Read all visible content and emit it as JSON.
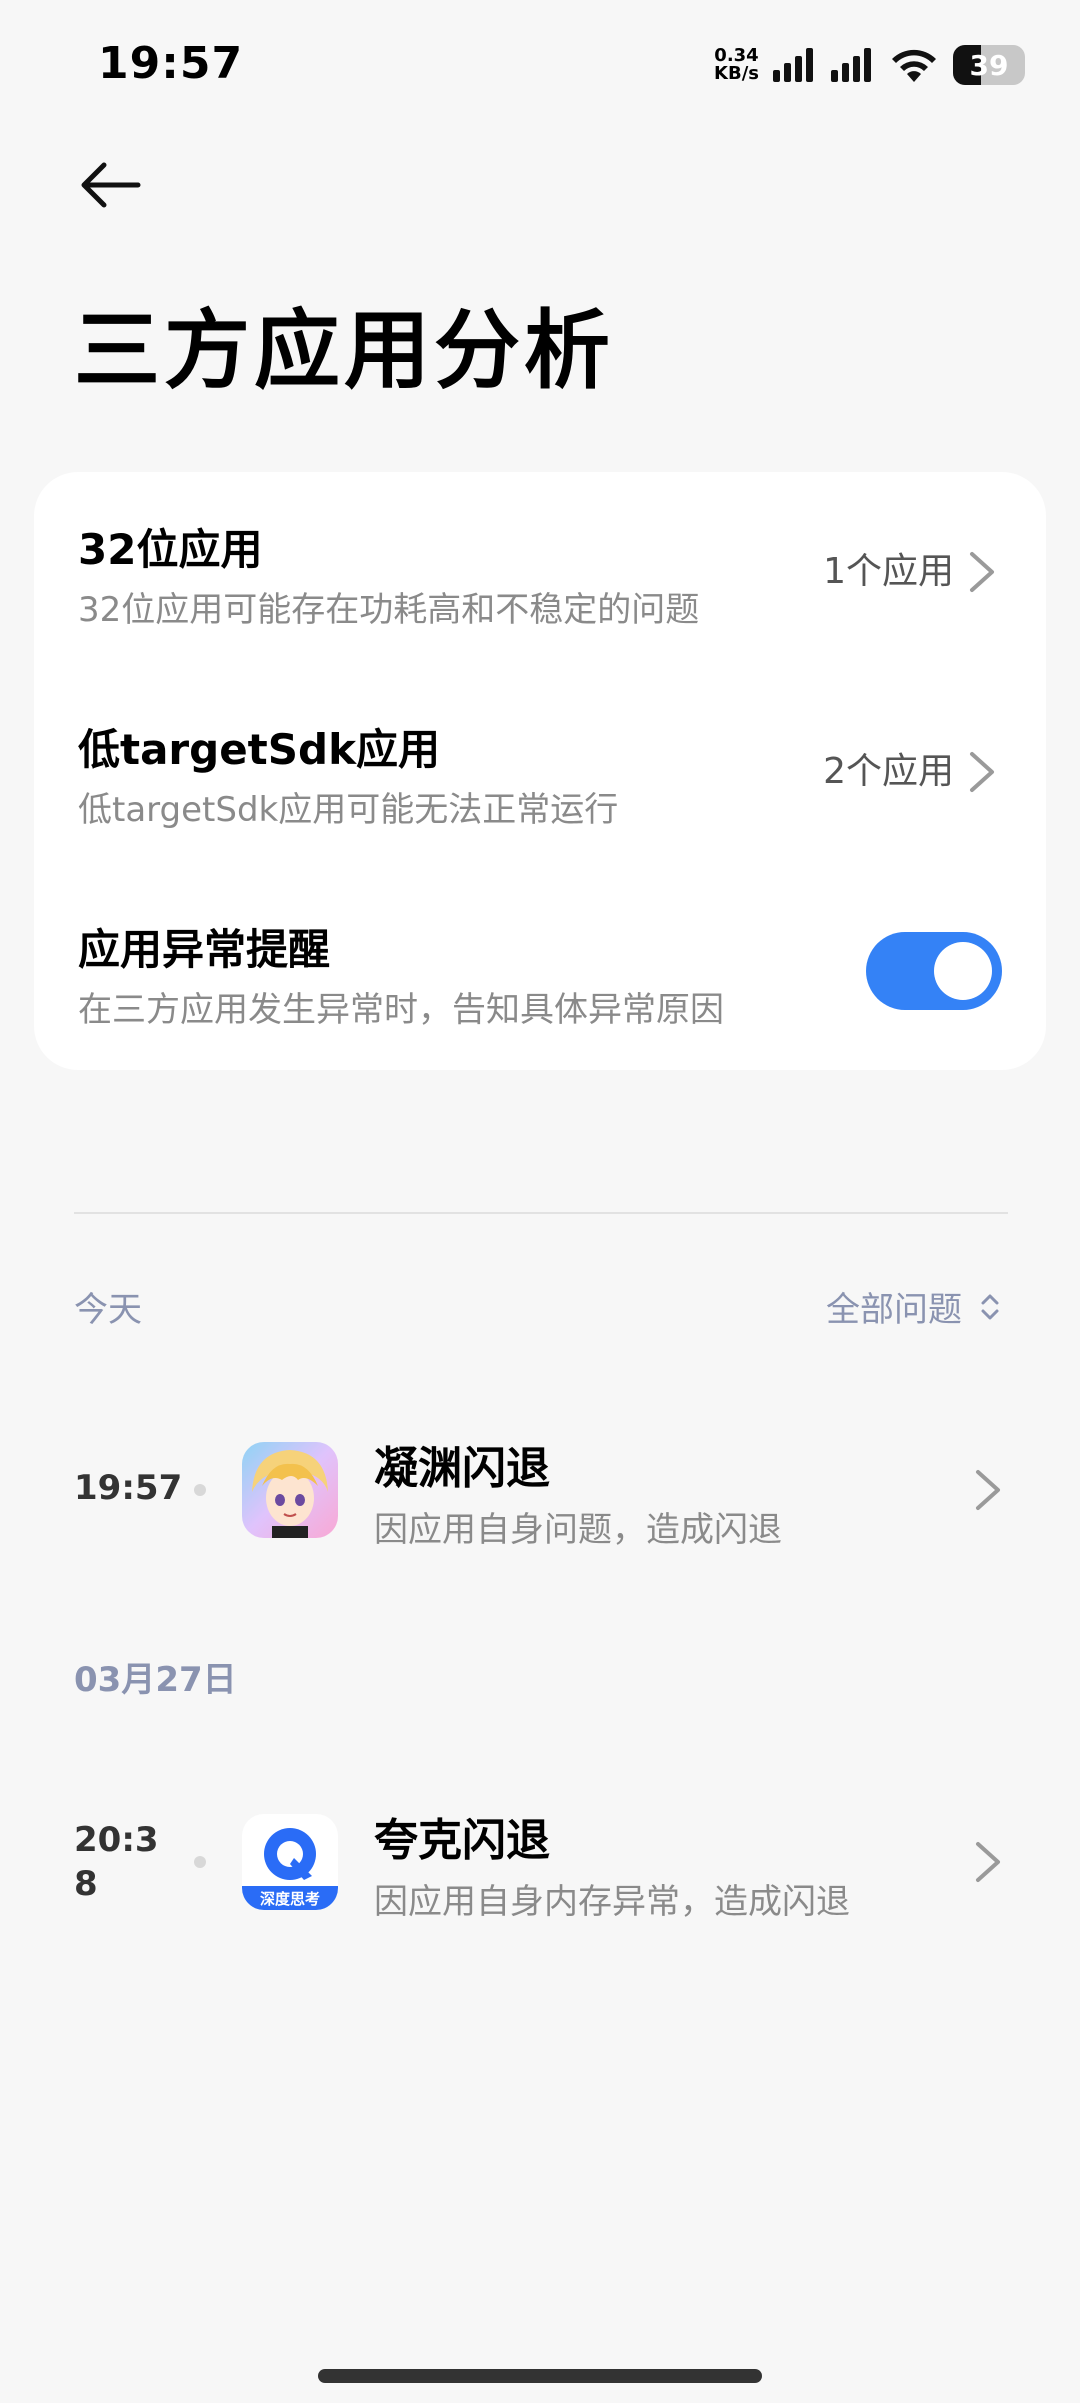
{
  "status_bar": {
    "time": "19:57",
    "net_speed_value": "0.34",
    "net_speed_unit": "KB/s",
    "battery": "39"
  },
  "header": {
    "title": "三方应用分析"
  },
  "settings": [
    {
      "title": "32位应用",
      "desc": "32位应用可能存在功耗高和不稳定的问题",
      "value": "1个应用"
    },
    {
      "title": "低targetSdk应用",
      "desc": "低targetSdk应用可能无法正常运行",
      "value": "2个应用"
    },
    {
      "title": "应用异常提醒",
      "desc": "在三方应用发生异常时，告知具体异常原因",
      "toggle_on": true
    }
  ],
  "history": {
    "filter_label": "全部问题",
    "sections": [
      {
        "date_label": "今天",
        "items": [
          {
            "time": "19:57",
            "title": "凝渊闪退",
            "desc": "因应用自身问题，造成闪退",
            "icon": "anime-character-app-icon"
          }
        ]
      },
      {
        "date_label": "03月27日",
        "items": [
          {
            "time": "20:3\n8",
            "title": "夸克闪退",
            "desc": "因应用自身内存异常，造成闪退",
            "icon": "quark-app-icon",
            "icon_badge": "深度思考"
          }
        ]
      }
    ]
  },
  "colors": {
    "accent": "#3482f6",
    "section_label": "#8a93b0",
    "background": "#f7f7f7"
  }
}
